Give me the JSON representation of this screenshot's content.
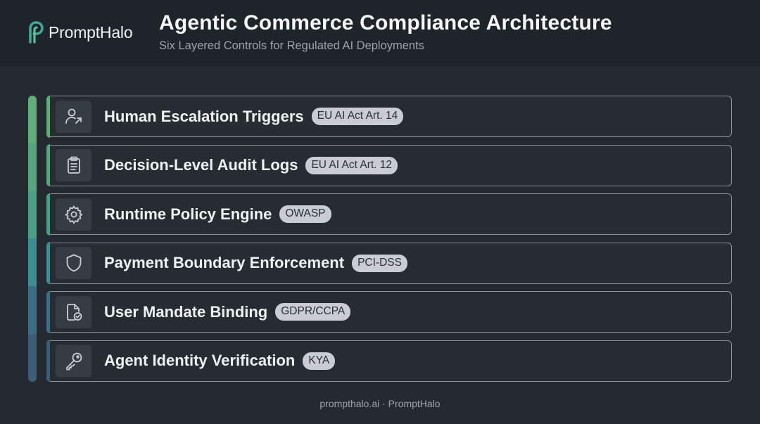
{
  "brand": {
    "name": "PromptHalo",
    "icon": "prompthalo-logo-icon"
  },
  "header": {
    "title": "Agentic Commerce Compliance Architecture",
    "subtitle": "Six Layered Controls for Regulated AI Deployments"
  },
  "layers": [
    {
      "label": "Human Escalation Triggers",
      "badge": "EU AI Act Art. 14",
      "icon": "person-escalation-icon",
      "accent": "#5fae78"
    },
    {
      "label": "Decision-Level Audit Logs",
      "badge": "EU AI Act Art. 12",
      "icon": "clipboard-icon",
      "accent": "#55a67f"
    },
    {
      "label": "Runtime Policy Engine",
      "badge": "OWASP",
      "icon": "gear-icon",
      "accent": "#4b9e86"
    },
    {
      "label": "Payment Boundary Enforcement",
      "badge": "PCI-DSS",
      "icon": "shield-icon",
      "accent": "#3c8d8f"
    },
    {
      "label": "User Mandate Binding",
      "badge": "GDPR/CCPA",
      "icon": "document-check-icon",
      "accent": "#3b6e86"
    },
    {
      "label": "Agent Identity Verification",
      "badge": "KYA",
      "icon": "key-icon",
      "accent": "#3b5d78"
    }
  ],
  "footer": {
    "text": "prompthalo.ai · PromptHalo"
  },
  "colors": {
    "background": "#252a31",
    "header_background": "#1f242b",
    "badge_background": "#c9cdd3",
    "rail_gradient": [
      "#5fae78",
      "#55a67f",
      "#4b9e86",
      "#3c8d8f",
      "#3b6e86",
      "#3b5d78"
    ]
  }
}
